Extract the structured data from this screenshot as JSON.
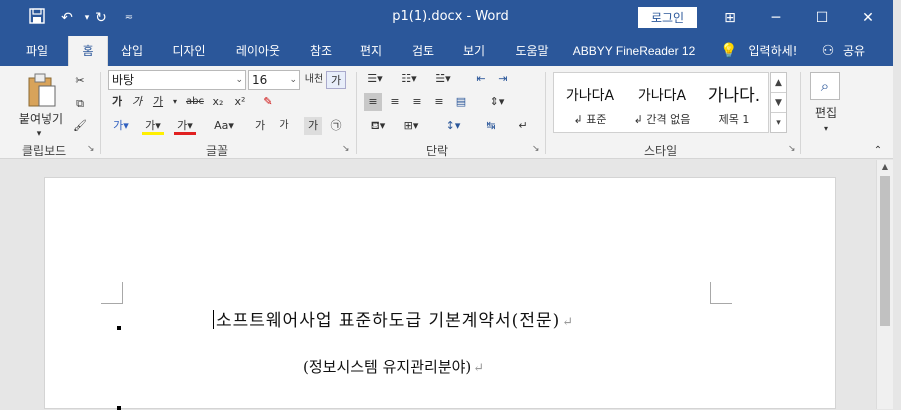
{
  "titlebar": {
    "title": "p1(1).docx  -  Word",
    "login_label": "로그인",
    "save_icon": "save-icon",
    "undo_icon": "undo-icon",
    "redo_icon": "redo-icon",
    "customize_icon": "customize-qat-icon",
    "ribbon_display_icon": "ribbon-display-options-icon",
    "minimize": "─",
    "maximize": "☐",
    "close": "✕"
  },
  "tabs": [
    "파일",
    "홈",
    "삽입",
    "디자인",
    "레이아웃",
    "참조",
    "편지",
    "검토",
    "보기",
    "도움말",
    "ABBYY FineReader 12"
  ],
  "active_tab": "홈",
  "tell_me": "입력하세!",
  "share": "공유",
  "ribbon": {
    "clipboard": {
      "label": "클립보드",
      "paste": "붙여넣기"
    },
    "font": {
      "label": "글꼴",
      "font_name": "바탕",
      "font_size": "16",
      "buttons": [
        "가",
        "가",
        "가",
        "abc",
        "x₂",
        "x²"
      ],
      "row3": [
        "가",
        "가",
        "가",
        "Aa",
        "가",
        "가",
        "가",
        "㉠"
      ]
    },
    "paragraph": {
      "label": "단락"
    },
    "styles": {
      "label": "스타일",
      "items": [
        {
          "sample": "가나다A",
          "name": "↲ 표준"
        },
        {
          "sample": "가나다A",
          "name": "↲ 간격 없음"
        },
        {
          "sample": "가나다.",
          "name": "제목 1"
        }
      ]
    },
    "editing": {
      "label": "편집"
    }
  },
  "document": {
    "heading": "소프트웨어사업 표준하도급 기본계약서(전문)",
    "subheading": "(정보시스템 유지관리분야)",
    "paragraph_mark": "↵"
  }
}
